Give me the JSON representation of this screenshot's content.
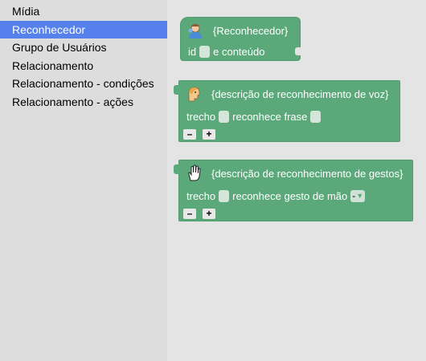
{
  "sidebar": {
    "items": [
      {
        "label": "Mídia",
        "selected": false
      },
      {
        "label": "Reconhecedor",
        "selected": true
      },
      {
        "label": "Grupo de Usuários",
        "selected": false
      },
      {
        "label": "Relacionamento",
        "selected": false
      },
      {
        "label": "Relacionamento - condições",
        "selected": false
      },
      {
        "label": "Relacionamento - ações",
        "selected": false
      }
    ]
  },
  "blocks": {
    "recognizer": {
      "title": "{Reconhecedor}",
      "icon": "recognizer-person-icon",
      "id_label": "id",
      "content_label": "e conteúdo"
    },
    "voice": {
      "title": "{descrição de reconhecimento de voz}",
      "icon": "speaking-head-icon",
      "segment_label": "trecho",
      "recognizes_label": "reconhece frase",
      "minus": "–",
      "plus": "+"
    },
    "gesture": {
      "title": "{descrição de reconhecimento de gestos}",
      "icon": "hand-icon",
      "segment_label": "trecho",
      "recognizes_label": "reconhece gesto de mão",
      "dropdown_value": "-",
      "dropdown_arrow": "▼",
      "minus": "–",
      "plus": "+"
    }
  },
  "colors": {
    "selected_bg": "#5680ec",
    "block_green": "#5ba97a",
    "sidebar_bg": "#dddddd",
    "workspace_bg": "#e4e4e4"
  }
}
